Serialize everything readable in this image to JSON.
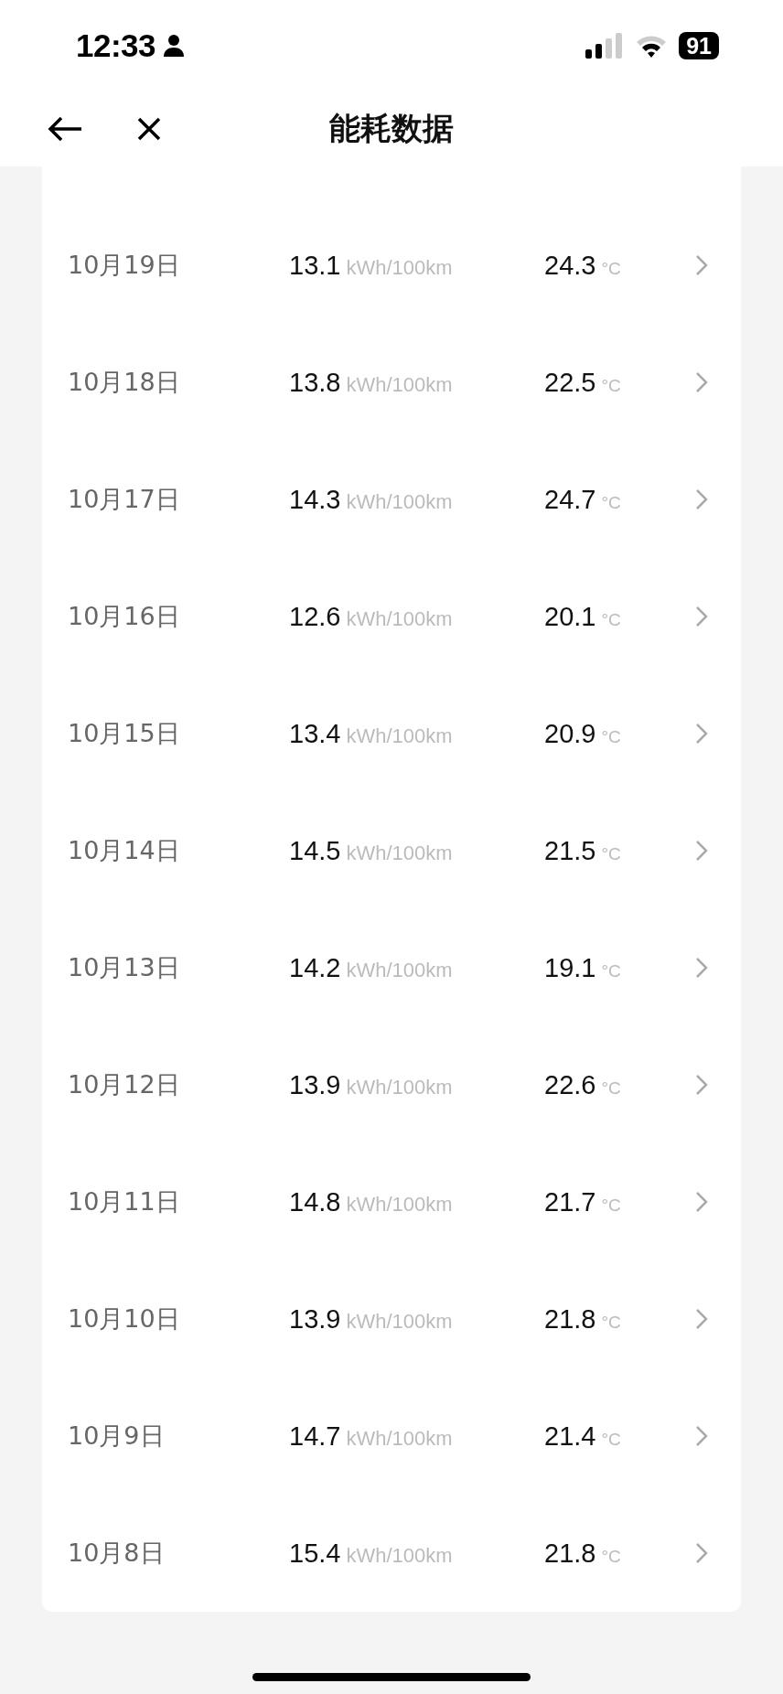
{
  "status_bar": {
    "time": "12:33",
    "battery": "91"
  },
  "header": {
    "title": "能耗数据"
  },
  "rows": [
    {
      "date": "10月19日",
      "consumption": "13.1",
      "consumption_unit": "kWh/100km",
      "temperature": "24.3",
      "temperature_unit": "°C"
    },
    {
      "date": "10月18日",
      "consumption": "13.8",
      "consumption_unit": "kWh/100km",
      "temperature": "22.5",
      "temperature_unit": "°C"
    },
    {
      "date": "10月17日",
      "consumption": "14.3",
      "consumption_unit": "kWh/100km",
      "temperature": "24.7",
      "temperature_unit": "°C"
    },
    {
      "date": "10月16日",
      "consumption": "12.6",
      "consumption_unit": "kWh/100km",
      "temperature": "20.1",
      "temperature_unit": "°C"
    },
    {
      "date": "10月15日",
      "consumption": "13.4",
      "consumption_unit": "kWh/100km",
      "temperature": "20.9",
      "temperature_unit": "°C"
    },
    {
      "date": "10月14日",
      "consumption": "14.5",
      "consumption_unit": "kWh/100km",
      "temperature": "21.5",
      "temperature_unit": "°C"
    },
    {
      "date": "10月13日",
      "consumption": "14.2",
      "consumption_unit": "kWh/100km",
      "temperature": "19.1",
      "temperature_unit": "°C"
    },
    {
      "date": "10月12日",
      "consumption": "13.9",
      "consumption_unit": "kWh/100km",
      "temperature": "22.6",
      "temperature_unit": "°C"
    },
    {
      "date": "10月11日",
      "consumption": "14.8",
      "consumption_unit": "kWh/100km",
      "temperature": "21.7",
      "temperature_unit": "°C"
    },
    {
      "date": "10月10日",
      "consumption": "13.9",
      "consumption_unit": "kWh/100km",
      "temperature": "21.8",
      "temperature_unit": "°C"
    },
    {
      "date": "10月9日",
      "consumption": "14.7",
      "consumption_unit": "kWh/100km",
      "temperature": "21.4",
      "temperature_unit": "°C"
    },
    {
      "date": "10月8日",
      "consumption": "15.4",
      "consumption_unit": "kWh/100km",
      "temperature": "21.8",
      "temperature_unit": "°C"
    }
  ]
}
